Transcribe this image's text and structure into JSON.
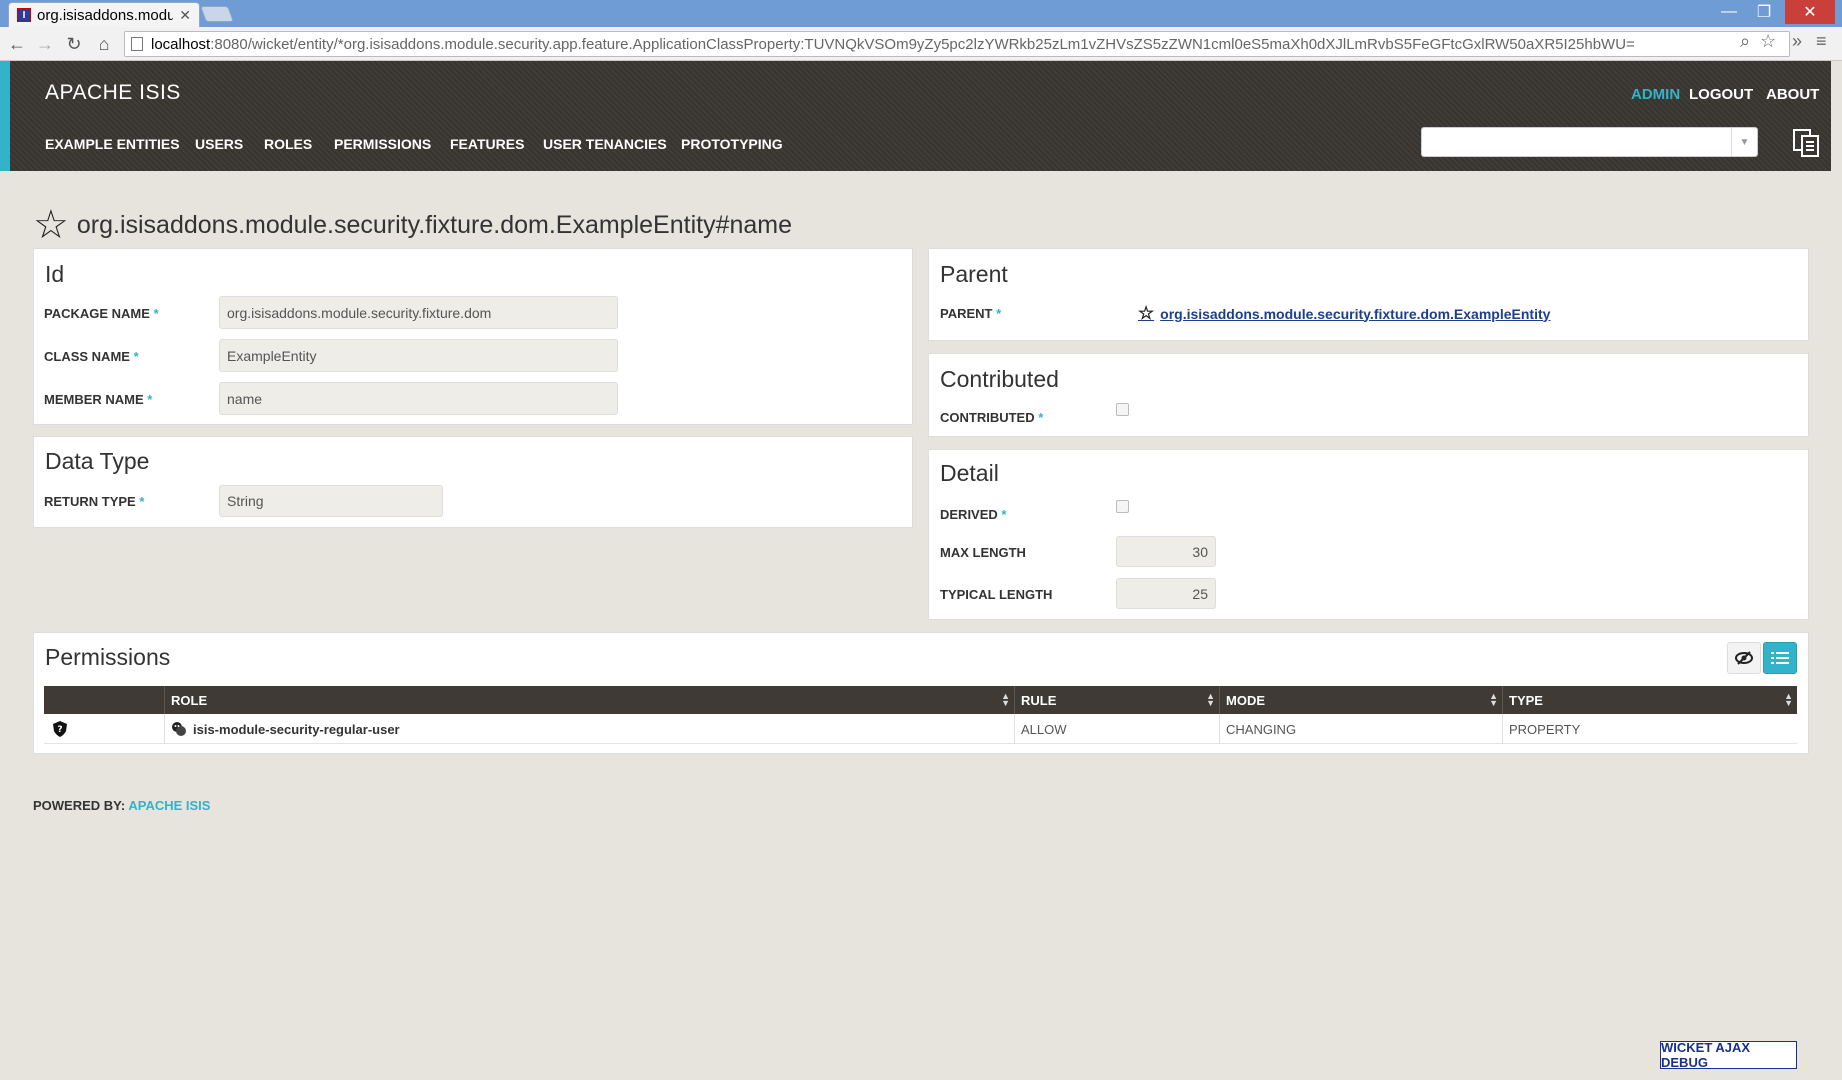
{
  "browser": {
    "tab_title": "org.isisaddons.modu",
    "url_host": "localhost",
    "url_path": ":8080/wicket/entity/*org.isisaddons.module.security.app.feature.ApplicationClassProperty:TUVNQkVSOm9yZy5pc2lzYWRkb25zLm1vZHVsZS5zZWN1cml0eS5maXh0dXJlLmRvbS5FeGFtcGxlRW50aXR5I25hbWU="
  },
  "header": {
    "brand": "APACHE ISIS",
    "user": "ADMIN",
    "logout": "LOGOUT",
    "about": "ABOUT",
    "menu": [
      "EXAMPLE ENTITIES",
      "USERS",
      "ROLES",
      "PERMISSIONS",
      "FEATURES",
      "USER TENANCIES",
      "PROTOTYPING"
    ],
    "accent_color": "#33b3c9"
  },
  "page": {
    "title": "org.isisaddons.module.security.fixture.dom.ExampleEntity#name"
  },
  "id_panel": {
    "heading": "Id",
    "package_label": "PACKAGE NAME",
    "package_value": "org.isisaddons.module.security.fixture.dom",
    "class_label": "CLASS NAME",
    "class_value": "ExampleEntity",
    "member_label": "MEMBER NAME",
    "member_value": "name"
  },
  "datatype_panel": {
    "heading": "Data Type",
    "return_label": "RETURN TYPE",
    "return_value": "String"
  },
  "parent_panel": {
    "heading": "Parent",
    "parent_label": "PARENT",
    "parent_value": "org.isisaddons.module.security.fixture.dom.ExampleEntity"
  },
  "contributed_panel": {
    "heading": "Contributed",
    "contributed_label": "CONTRIBUTED"
  },
  "detail_panel": {
    "heading": "Detail",
    "derived_label": "DERIVED",
    "max_label": "MAX LENGTH",
    "max_value": "30",
    "typical_label": "TYPICAL LENGTH",
    "typical_value": "25"
  },
  "permissions": {
    "heading": "Permissions",
    "columns": [
      "ROLE",
      "RULE",
      "MODE",
      "TYPE"
    ],
    "rows": [
      {
        "role": "isis-module-security-regular-user",
        "rule": "ALLOW",
        "mode": "CHANGING",
        "type": "PROPERTY"
      }
    ]
  },
  "footer": {
    "powered_by": "POWERED BY:",
    "link": "APACHE ISIS",
    "debug": "WICKET AJAX DEBUG"
  }
}
